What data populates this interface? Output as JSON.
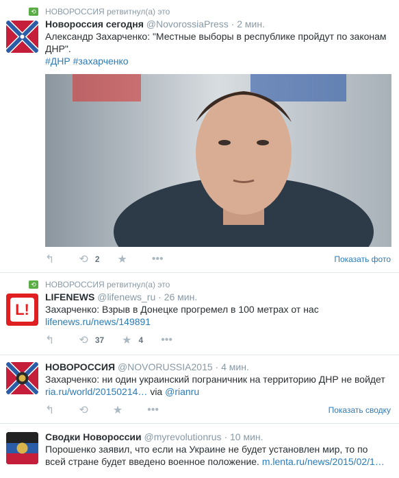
{
  "tweets": [
    {
      "retweeted_by": "НОВОРОССИЯ ретвитнул(а) это",
      "name": "Новороссия сегодня",
      "handle": "@NovorossiaPress",
      "time": "· 2 мин.",
      "text": "Александр Захарченко: \"Местные выборы в республике пройдут по законам ДНР\".",
      "hashtags": "#ДНР #захарченко",
      "retweets": "2",
      "favorites": "",
      "show_more": "Показать фото"
    },
    {
      "retweeted_by": "НОВОРОССИЯ ретвитнул(а) это",
      "name": "LIFENEWS",
      "handle": "@lifenews_ru",
      "time": "· 26 мин.",
      "text": "Захарченко: Взрыв в Донецке прогремел в 100 метрах от нас",
      "link": "lifenews.ru/news/149891",
      "retweets": "37",
      "favorites": "4"
    },
    {
      "name": "НОВОРОССИЯ",
      "handle": "@NOVORUSSIA2015",
      "time": "· 4 мин.",
      "text": "Захарченко: ни один украинский пограничник на территорию ДНР не войдет",
      "link": "ria.ru/world/20150214…",
      "via_word": "via",
      "via_handle": "@rianru",
      "show_more": "Показать сводку"
    },
    {
      "name": "Сводки Новороссии",
      "handle": "@myrevolutionrus",
      "time": "· 10 мин.",
      "text": "Порошенко заявил, что если на Украине не будет установлен мир, то по всей стране будет введено военное положение.",
      "link": "m.lenta.ru/news/2015/02/1…"
    }
  ],
  "logo_text": "L!",
  "colors": {
    "accent": "#2b7bb9",
    "muted": "#8899a6",
    "retweet": "#5aac44",
    "border": "#e1e8ed"
  },
  "icons": [
    "reply-icon",
    "retweet-icon",
    "favorite-icon",
    "more-icon",
    "retweet-indicator-icon"
  ]
}
